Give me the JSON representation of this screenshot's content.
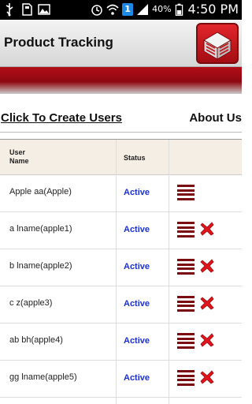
{
  "status_bar": {
    "battery_pct": "40%",
    "time": "4:50 PM",
    "icons": [
      "usb-icon",
      "sd-card-icon",
      "image-icon",
      "alarm-icon",
      "wifi-icon",
      "sync-badge-icon",
      "signal-icon",
      "battery-icon"
    ],
    "badge_text": "1"
  },
  "header": {
    "title": "Product Tracking",
    "logo": "product-box-icon"
  },
  "links": {
    "create_users": "Click To Create Users",
    "about_us": "About Us"
  },
  "table": {
    "columns": [
      "User Name",
      "Status",
      ""
    ],
    "user_col_line1": "User",
    "user_col_line2": "Name",
    "status_col": "Status",
    "rows": [
      {
        "name": "Apple aa(Apple)",
        "status": "Active",
        "deletable": false
      },
      {
        "name": "a lname(apple1)",
        "status": "Active",
        "deletable": true
      },
      {
        "name": "b lname(apple2)",
        "status": "Active",
        "deletable": true
      },
      {
        "name": "c z(apple3)",
        "status": "Active",
        "deletable": true
      },
      {
        "name": "ab bh(apple4)",
        "status": "Active",
        "deletable": true
      },
      {
        "name": "gg lname(apple5)",
        "status": "Active",
        "deletable": true
      }
    ]
  },
  "colors": {
    "accent_red": "#8e0810",
    "status_blue": "#1a2fd0",
    "delete_red": "#e0141c",
    "header_bg": "#f5eee4"
  }
}
